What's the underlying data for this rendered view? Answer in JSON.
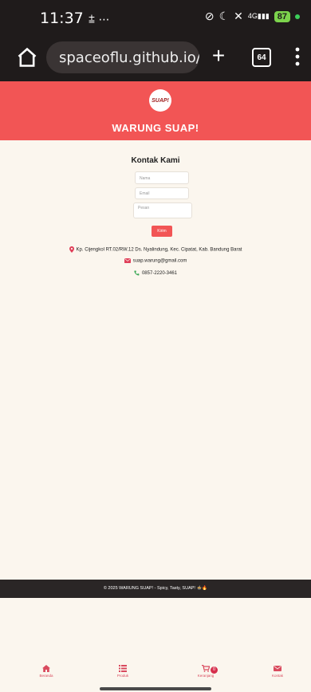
{
  "status_bar": {
    "time": "11:37",
    "extra": "⩲ ⋯",
    "signal": "4G",
    "battery": "87"
  },
  "browser": {
    "url": "spaceoflu.github.io/l",
    "tab_count": "64"
  },
  "header": {
    "logo_text": "SUAP!",
    "title": "WARUNG SUAP!"
  },
  "contact": {
    "heading": "Kontak Kami",
    "name_placeholder": "Nama",
    "email_placeholder": "Email",
    "message_placeholder": "Pesan",
    "send_label": "Kirim",
    "address": "Kp. Cijengkol RT.02/RW.12 Ds. Nyalindung, Kec. Cipatat, Kab. Bandung Barat",
    "email": "suap.warung@gmail.com",
    "phone": "0857-2220-3461"
  },
  "footer": {
    "text": "© 2025 WARUNG SUAP! - Spicy, Tasty, SUAP! 🍲🔥"
  },
  "bottom_nav": {
    "items": [
      {
        "label": "Beranda",
        "icon": "home-icon"
      },
      {
        "label": "Produk",
        "icon": "list-icon"
      },
      {
        "label": "Keranjang",
        "icon": "cart-icon",
        "badge": "0"
      },
      {
        "label": "Kontak",
        "icon": "envelope-icon"
      }
    ]
  },
  "colors": {
    "brand": "#f25555",
    "dark": "#1f1b1b",
    "background": "#fbf6ee"
  }
}
